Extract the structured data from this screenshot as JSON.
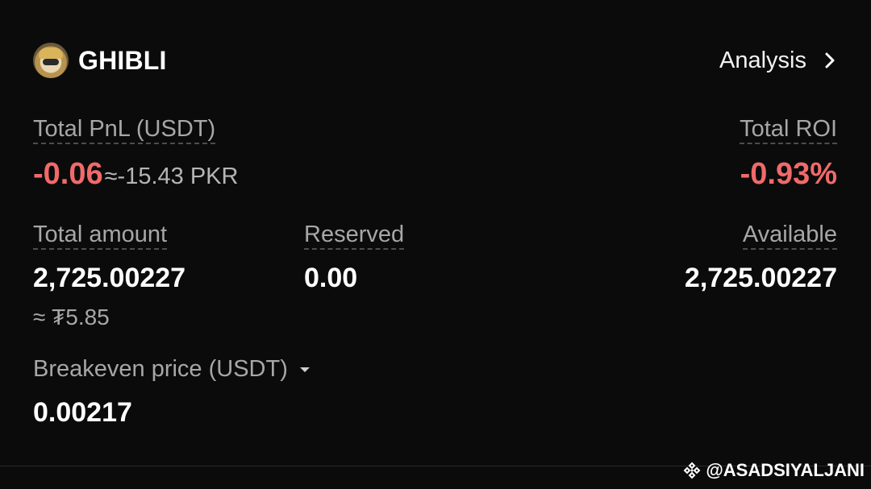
{
  "header": {
    "token_name": "GHIBLI",
    "analysis_label": "Analysis"
  },
  "pnl": {
    "label": "Total PnL (USDT)",
    "value": "-0.06",
    "approx": "≈-15.43 PKR"
  },
  "roi": {
    "label": "Total ROI",
    "value": "-0.93%"
  },
  "holdings": {
    "total_label": "Total amount",
    "total_value": "2,725.00227",
    "total_approx": "≈ ₮5.85",
    "reserved_label": "Reserved",
    "reserved_value": "0.00",
    "available_label": "Available",
    "available_value": "2,725.00227"
  },
  "breakeven": {
    "label": "Breakeven price (USDT)",
    "value": "0.00217"
  },
  "watermark": {
    "text": "@ASADSIYALJANI"
  },
  "colors": {
    "background": "#0b0b0b",
    "negative": "#f06a6a",
    "muted": "#a7a7a7"
  },
  "icons": [
    "token-avatar-icon",
    "chevron-right-icon",
    "caret-down-icon",
    "binance-logo-icon"
  ]
}
